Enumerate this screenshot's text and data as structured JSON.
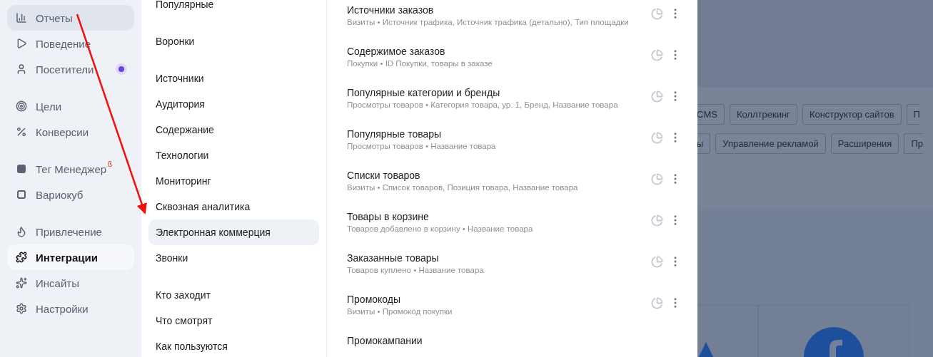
{
  "sidebar": {
    "groups": [
      [
        {
          "label": "Отчеты",
          "open": true,
          "selected": false
        },
        {
          "label": "Поведение",
          "open": false,
          "selected": false
        },
        {
          "label": "Посетители",
          "open": false,
          "selected": false,
          "notification": true
        }
      ],
      [
        {
          "label": "Цели",
          "open": false,
          "selected": false
        },
        {
          "label": "Конверсии",
          "open": false,
          "selected": false
        }
      ],
      [
        {
          "label": "Тег Менеджер",
          "open": false,
          "selected": false,
          "beta_mark": "ß"
        },
        {
          "label": "Вариокуб",
          "open": false,
          "selected": false
        }
      ],
      [
        {
          "label": "Привлечение",
          "open": false,
          "selected": false
        },
        {
          "label": "Интеграции",
          "open": false,
          "selected": true
        },
        {
          "label": "Инсайты",
          "open": false,
          "selected": false
        },
        {
          "label": "Настройки",
          "open": false,
          "selected": false
        }
      ]
    ]
  },
  "report_menu": {
    "groups": [
      [
        {
          "label": "Популярные",
          "selected": false
        }
      ],
      [
        {
          "label": "Воронки",
          "selected": false
        }
      ],
      [
        {
          "label": "Источники",
          "selected": false
        },
        {
          "label": "Аудитория",
          "selected": false
        },
        {
          "label": "Содержание",
          "selected": false
        },
        {
          "label": "Технологии",
          "selected": false
        },
        {
          "label": "Мониторинг",
          "selected": false
        },
        {
          "label": "Сквозная аналитика",
          "selected": false
        },
        {
          "label": "Электронная коммерция",
          "selected": true
        },
        {
          "label": "Звонки",
          "selected": false
        }
      ],
      [
        {
          "label": "Кто заходит",
          "selected": false
        },
        {
          "label": "Что смотрят",
          "selected": false
        },
        {
          "label": "Как пользуются",
          "selected": false
        }
      ]
    ]
  },
  "reports": [
    {
      "title": "Источники заказов",
      "subtitle": "Визиты • Источник трафика, Источник трафика (детально), Тип площадки"
    },
    {
      "title": "Содержимое заказов",
      "subtitle": "Покупки • ID Покупки, товары в заказе"
    },
    {
      "title": "Популярные категории и бренды",
      "subtitle": "Просмотры товаров • Категория товара, ур. 1, Бренд, Название товара"
    },
    {
      "title": "Популярные товары",
      "subtitle": "Просмотры товаров • Название товара"
    },
    {
      "title": "Списки товаров",
      "subtitle": "Визиты • Список товаров, Позиция товара, Название товара"
    },
    {
      "title": "Товары в корзине",
      "subtitle": "Товаров добавлено в корзину • Название товара"
    },
    {
      "title": "Заказанные товары",
      "subtitle": "Товаров куплено • Название товара"
    },
    {
      "title": "Промокоды",
      "subtitle": "Визиты • Промокод покупки"
    },
    {
      "title": "Промокампании"
    }
  ],
  "background": {
    "chip_rows": [
      [
        {
          "label": "CMS",
          "kind": "cut-left"
        },
        {
          "label": "Коллтрекинг",
          "kind": "whole"
        },
        {
          "label": "Конструктор сайтов",
          "kind": "whole"
        },
        {
          "label": "П",
          "kind": "cut-right"
        }
      ],
      [
        {
          "label": "ы",
          "kind": "cut-left"
        },
        {
          "label": "Управление рекламой",
          "kind": "whole"
        },
        {
          "label": "Расширения",
          "kind": "whole"
        },
        {
          "label": "Пр",
          "kind": "cut-right"
        }
      ]
    ]
  }
}
